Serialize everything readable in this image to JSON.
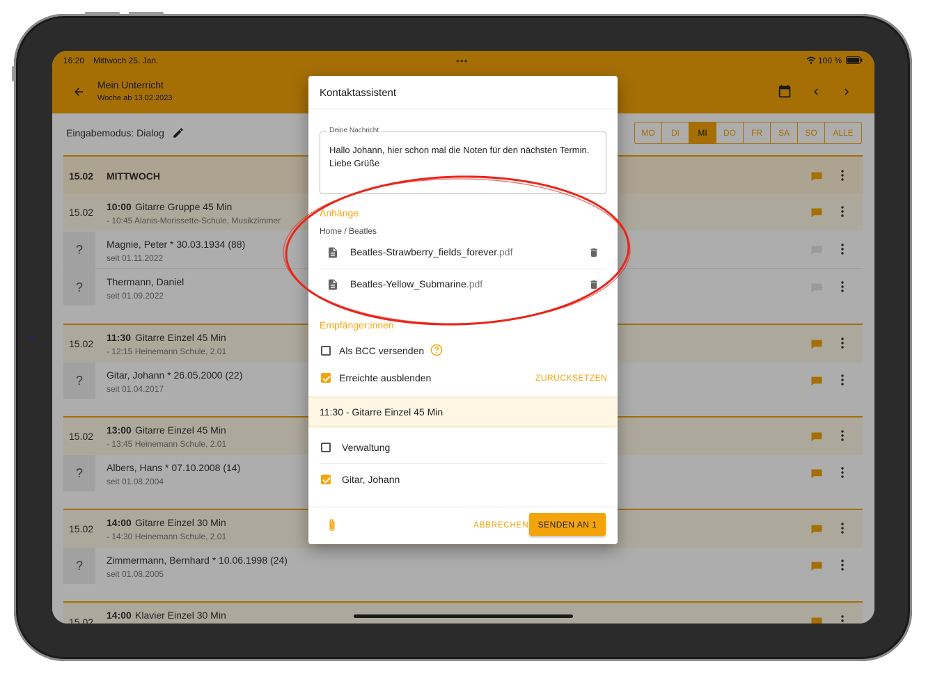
{
  "status_bar": {
    "time": "16:20",
    "date": "Mittwoch 25. Jan.",
    "battery": "100 %"
  },
  "app_bar": {
    "title": "Mein Unterricht",
    "subtitle": "Woche ab 13.02.2023"
  },
  "mode": {
    "label": "Eingabemodus: Dialog"
  },
  "days": [
    "MO",
    "DI",
    "MI",
    "DO",
    "FR",
    "SA",
    "SO",
    "ALLE"
  ],
  "selected_day": "MI",
  "schedule": {
    "day_header": {
      "date": "15.02",
      "weekday": "MITTWOCH"
    },
    "lessons": [
      {
        "date": "15.02",
        "time": "10:00",
        "title": "Gitarre Gruppe 45 Min",
        "detail": "- 10:45 Alanis-Morissette-Schule, Musikzimmer",
        "students": [
          {
            "mark": "?",
            "name": "Magnie, Peter * 30.03.1934 (88)",
            "since": "seit 01.11.2022"
          },
          {
            "mark": "?",
            "name": "Thermann, Daniel",
            "since": "seit 01.09.2022"
          }
        ]
      },
      {
        "date": "15.02",
        "time": "11:30",
        "title": "Gitarre Einzel 45 Min",
        "detail": "- 12:15 Heinemann Schule, 2.01",
        "students": [
          {
            "mark": "?",
            "name": "Gitar, Johann * 26.05.2000 (22)",
            "since": "seit 01.04.2017"
          }
        ]
      },
      {
        "date": "15.02",
        "time": "13:00",
        "title": "Gitarre Einzel 45 Min",
        "detail": "- 13:45 Heinemann Schule, 2.01",
        "students": [
          {
            "mark": "?",
            "name": "Albers, Hans * 07.10.2008 (14)",
            "since": "seit 01.08.2004"
          }
        ]
      },
      {
        "date": "15.02",
        "time": "14:00",
        "title": "Gitarre Einzel 30 Min",
        "detail": "- 14:30 Heinemann Schule, 2.01",
        "students": [
          {
            "mark": "?",
            "name": "Zimmermann, Bernhard * 10.06.1998 (24)",
            "since": "seit 01.08.2005"
          }
        ]
      },
      {
        "date": "15.02",
        "time": "14:00",
        "title": "Klavier Einzel 30 Min",
        "detail": "",
        "students": []
      }
    ]
  },
  "dialog": {
    "title": "Kontaktassistent",
    "message_label": "Deine Nachricht",
    "message": "Hallo Johann, hier schon mal die Noten für den nächsten Termin. Liebe Grüße",
    "attachments_title": "Anhänge",
    "breadcrumb": "Home / Beatles",
    "attachments": [
      {
        "name": "Beatles-Strawberry_fields_forever",
        "ext": ".pdf"
      },
      {
        "name": "Beatles-Yellow_Submarine",
        "ext": ".pdf"
      }
    ],
    "recipients_title": "Empfänger:innen",
    "bcc_label": "Als BCC versenden",
    "bcc_checked": false,
    "hide_reached_label": "Erreichte ausblenden",
    "hide_reached_checked": true,
    "reset_label": "ZURÜCKSETZEN",
    "group_label": "11:30 - Gitarre Einzel 45 Min",
    "recipients": [
      {
        "name": "Verwaltung",
        "checked": false
      },
      {
        "name": "Gitar, Johann",
        "checked": true
      }
    ],
    "cancel_label": "ABBRECHEN",
    "send_label": "SENDEN AN 1"
  },
  "colors": {
    "accent": "#f4a40a",
    "annotation": "#e8261b",
    "scrim": "rgba(0,0,0,0.32)"
  }
}
